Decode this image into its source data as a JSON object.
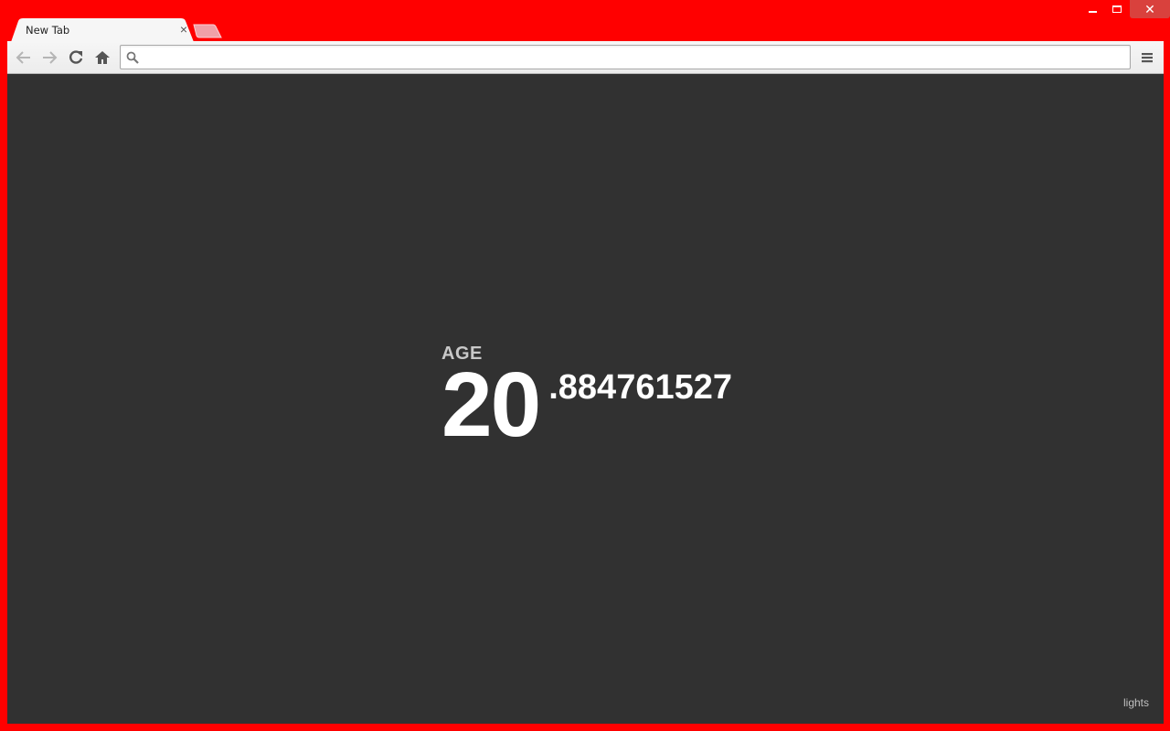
{
  "window": {
    "controls": {
      "minimize": "minimize",
      "maximize": "maximize",
      "close": "✕"
    }
  },
  "tabs": [
    {
      "title": "New Tab",
      "active": true,
      "close_glyph": "×"
    }
  ],
  "toolbar": {
    "back_icon": "back-arrow-icon",
    "forward_icon": "forward-arrow-icon",
    "reload_icon": "reload-icon",
    "home_icon": "home-icon",
    "menu_icon": "hamburger-menu-icon"
  },
  "omnibox": {
    "value": "",
    "placeholder": ""
  },
  "page": {
    "background": "#313131",
    "age_label": "AGE",
    "age_integer": "20",
    "age_fraction": ".884761527",
    "lights_link": "lights"
  },
  "colors": {
    "frame": "#ff0000",
    "close_button": "#d9413d",
    "text_primary": "#ffffff",
    "text_muted": "#c8c8c8"
  }
}
